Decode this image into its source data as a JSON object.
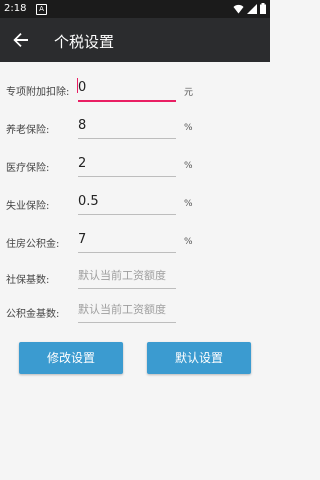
{
  "status_bar": {
    "time": "2:18",
    "notification_icon": "A"
  },
  "app_bar": {
    "title": "个税设置"
  },
  "fields": [
    {
      "label": "专项附加扣除:",
      "value": "0",
      "unit": "元"
    },
    {
      "label": "养老保险:",
      "value": "8",
      "unit": "%"
    },
    {
      "label": "医疗保险:",
      "value": "2",
      "unit": "%"
    },
    {
      "label": "失业保险:",
      "value": "0.5",
      "unit": "%"
    },
    {
      "label": "住房公积金:",
      "value": "7",
      "unit": "%"
    },
    {
      "label": "社保基数:",
      "placeholder": "默认当前工资额度"
    },
    {
      "label": "公积金基数:",
      "placeholder": "默认当前工资额度"
    }
  ],
  "buttons": {
    "modify": "修改设置",
    "default": "默认设置"
  },
  "colors": {
    "accent": "#e91e63",
    "button": "#3b9bd0",
    "app_bar": "#2b2c2e"
  }
}
